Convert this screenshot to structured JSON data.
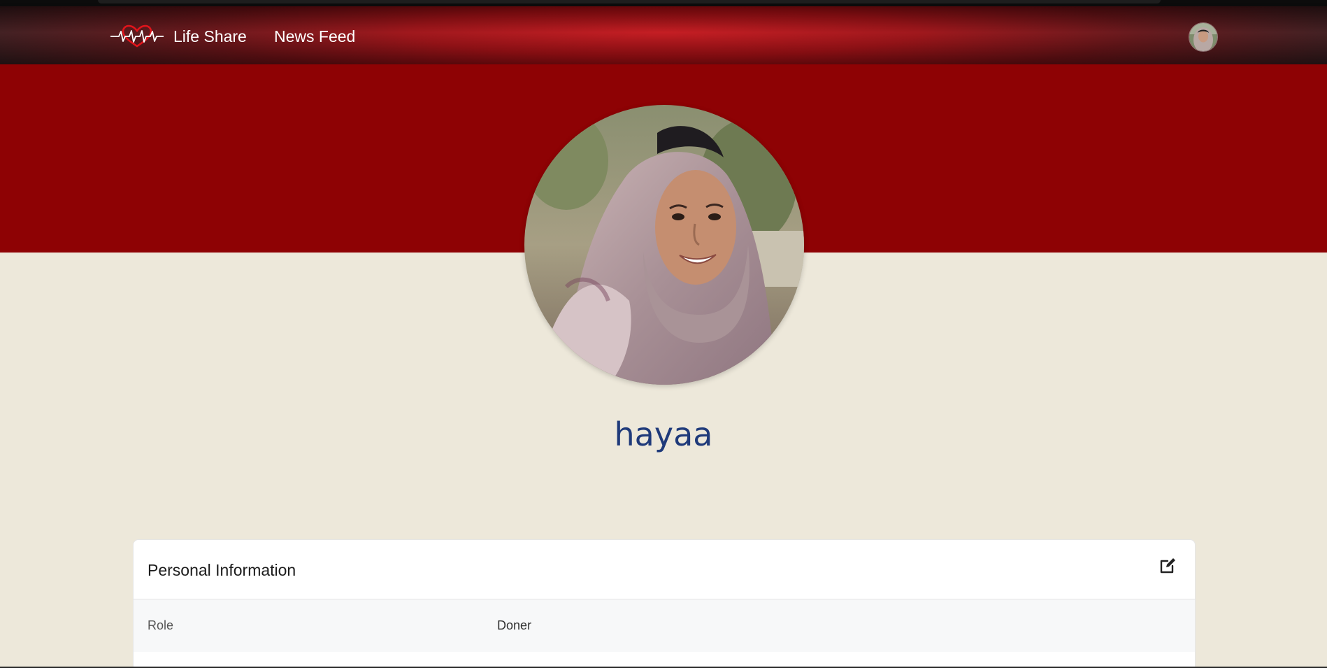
{
  "navbar": {
    "brand_label": "Life Share",
    "news_feed_label": "News Feed"
  },
  "profile": {
    "username": "hayaa"
  },
  "personal_info": {
    "title": "Personal Information",
    "rows": [
      {
        "label": "Role",
        "value": "Doner"
      }
    ]
  },
  "colors": {
    "navbar_red": "#9a0a0f",
    "banner_red": "#8e0204",
    "page_background": "#ede8da",
    "username_blue": "#1f3a7a"
  },
  "icons": {
    "brand": "heartbeat-heart-icon",
    "edit": "edit-square-icon"
  }
}
